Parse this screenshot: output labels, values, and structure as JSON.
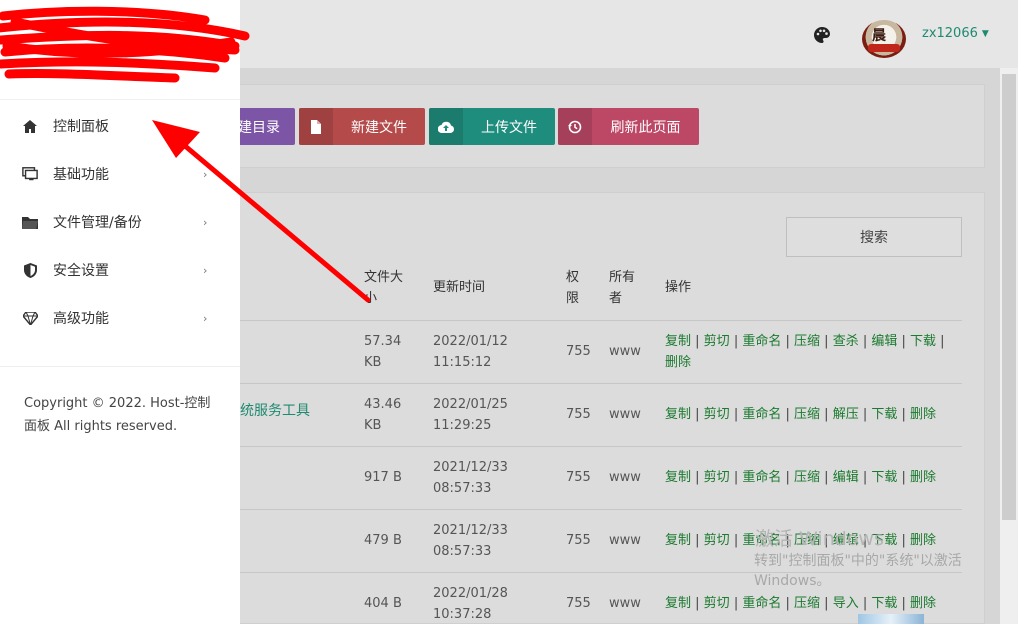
{
  "header": {
    "username": "zx12066",
    "avatar_text": "晨"
  },
  "toolbar": {
    "mkdir_label": "建目录",
    "newfile_label": "新建文件",
    "upload_label": "上传文件",
    "refresh_label": "刷新此页面"
  },
  "search": {
    "label": "搜索"
  },
  "table": {
    "headers": {
      "size_1": "文件大",
      "size_2": "小",
      "mtime": "更新时间",
      "perm_1": "权",
      "perm_2": "限",
      "owner_1": "所有",
      "owner_2": "者",
      "ops": "操作"
    },
    "rows": [
      {
        "name": "",
        "size_1": "57.34",
        "size_2": "KB",
        "date": "2022/01/12",
        "time": "11:15:12",
        "perm": "755",
        "owner": "www",
        "ops": [
          "复制",
          "剪切",
          "重命名",
          "压缩",
          "查杀",
          "编辑",
          "下载",
          "删除"
        ]
      },
      {
        "name": "统服务工具",
        "size_1": "43.46",
        "size_2": "KB",
        "date": "2022/01/25",
        "time": "11:29:25",
        "perm": "755",
        "owner": "www",
        "ops": [
          "复制",
          "剪切",
          "重命名",
          "压缩",
          "解压",
          "下载",
          "删除"
        ]
      },
      {
        "name": "",
        "size_1": "917 B",
        "size_2": "",
        "date": "2021/12/33",
        "time": "08:57:33",
        "perm": "755",
        "owner": "www",
        "ops": [
          "复制",
          "剪切",
          "重命名",
          "压缩",
          "编辑",
          "下载",
          "删除"
        ]
      },
      {
        "name": "",
        "size_1": "479 B",
        "size_2": "",
        "date": "2021/12/33",
        "time": "08:57:33",
        "perm": "755",
        "owner": "www",
        "ops": [
          "复制",
          "剪切",
          "重命名",
          "压缩",
          "编辑",
          "下载",
          "删除"
        ]
      },
      {
        "name": "",
        "size_1": "404 B",
        "size_2": "",
        "date": "2022/01/28",
        "time": "10:37:28",
        "perm": "755",
        "owner": "www",
        "ops": [
          "复制",
          "剪切",
          "重命名",
          "压缩",
          "导入",
          "下载",
          "删除"
        ]
      }
    ]
  },
  "sidebar": {
    "items": [
      {
        "label": "控制面板",
        "icon": "home-icon",
        "has_children": false
      },
      {
        "label": "基础功能",
        "icon": "monitor-icon",
        "has_children": true
      },
      {
        "label": "文件管理/备份",
        "icon": "folder-icon",
        "has_children": true
      },
      {
        "label": "安全设置",
        "icon": "shield-icon",
        "has_children": true
      },
      {
        "label": "高级功能",
        "icon": "diamond-icon",
        "has_children": true
      }
    ],
    "copyright": "Copyright © 2022. Host-控制面板 All rights reserved."
  },
  "watermark": {
    "title": "激活 Windows",
    "subtitle": "转到\"控制面板\"中的\"系统\"以激活Windows。"
  },
  "colors": {
    "accent_green": "#1f8a70",
    "link_green": "#1a7a2e",
    "btn_purple": "#7c55a6",
    "btn_red": "#b54a4a",
    "btn_teal": "#1f8d7d",
    "btn_pink": "#bd4866",
    "annotation_red": "#ff0000"
  }
}
